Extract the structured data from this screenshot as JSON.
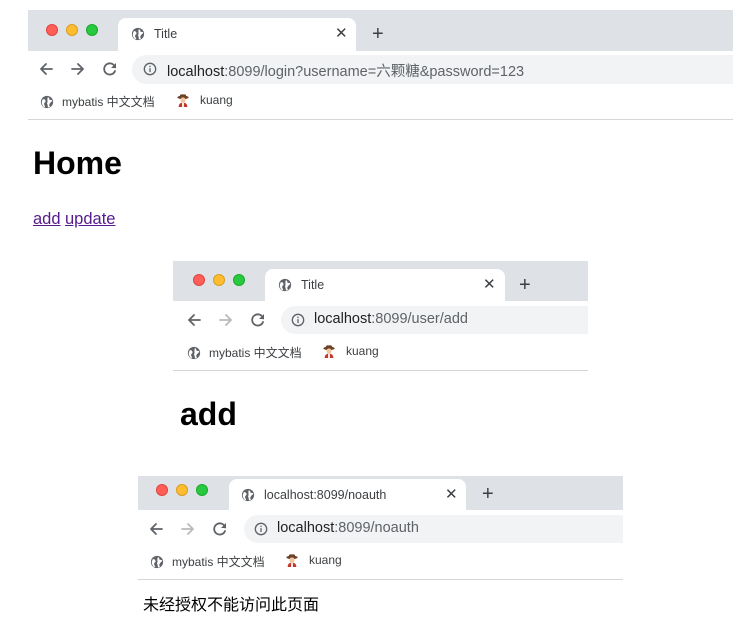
{
  "windows": [
    {
      "tab_title": "Title",
      "url_host": "localhost",
      "url_rest": ":8099/login?username=六颗糖&password=123",
      "bookmarks": [
        "mybatis 中文文档",
        "kuang"
      ],
      "heading": "Home",
      "links": [
        "add",
        "update"
      ]
    },
    {
      "tab_title": "Title",
      "url_host": "localhost",
      "url_rest": ":8099/user/add",
      "bookmarks": [
        "mybatis 中文文档",
        "kuang"
      ],
      "heading": "add"
    },
    {
      "tab_title": "localhost:8099/noauth",
      "url_host": "localhost",
      "url_rest": ":8099/noauth",
      "bookmarks": [
        "mybatis 中文文档",
        "kuang"
      ],
      "body_text": "未经授权不能访问此页面"
    }
  ],
  "icons": {
    "tab": "globe-icon",
    "close": "close-icon",
    "new_tab": "plus-icon",
    "back": "back-arrow-icon",
    "forward": "forward-arrow-icon",
    "reload": "reload-icon",
    "site_info": "info-icon",
    "bookmark_1": "globe-icon",
    "bookmark_2": "avatar-icon"
  },
  "colors": {
    "tabstrip": "#dee1e6",
    "omnibox": "#f1f3f4",
    "visited_link": "#551a8b",
    "close_dot": "#ff5f57",
    "minimize_dot": "#febc2e",
    "zoom_dot": "#28c840"
  }
}
